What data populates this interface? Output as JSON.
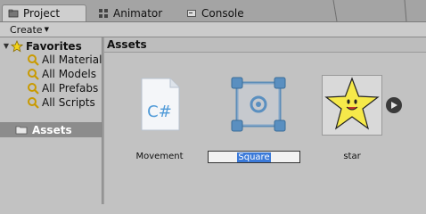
{
  "tabs": [
    {
      "label": "Project",
      "icon": "project-folder-icon",
      "active": true
    },
    {
      "label": "Animator",
      "icon": "animator-icon",
      "active": false
    },
    {
      "label": "Console",
      "icon": "console-icon",
      "active": false
    }
  ],
  "toolbar": {
    "create_label": "Create"
  },
  "tree": {
    "favorites_label": "Favorites",
    "favorite_items": [
      "All Materials",
      "All Models",
      "All Prefabs",
      "All Scripts"
    ],
    "assets_label": "Assets"
  },
  "content": {
    "header": "Assets",
    "assets": [
      {
        "name": "Movement",
        "icon": "csharp-script-icon",
        "selected": false
      },
      {
        "name": "Square",
        "icon": "sprite-square-icon",
        "selected": true,
        "renaming": true
      },
      {
        "name": "star",
        "icon": "star-sprite-icon",
        "selected": false
      }
    ],
    "csharp_glyph": "C#"
  },
  "colors": {
    "selection_blue": "#3b7ad9",
    "tree_selected_bg": "#8c8c8c",
    "star_yellow": "#f6e94a"
  }
}
